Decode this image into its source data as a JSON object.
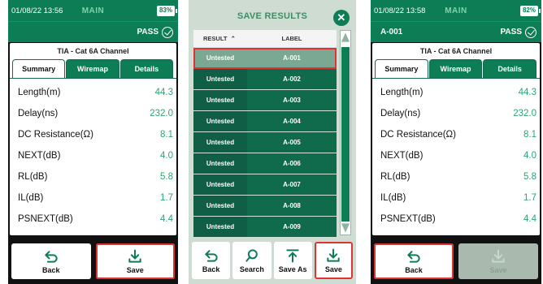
{
  "left": {
    "status": {
      "datetime": "01/08/22 13:56",
      "mode": "MAIN",
      "battery": "83%"
    },
    "header": {
      "label": "",
      "result": "PASS"
    },
    "title": "TIA - Cat 6A Channel",
    "tabs": [
      "Summary",
      "Wiremap",
      "Details"
    ],
    "rows": [
      {
        "label": "Length(m)",
        "value": "44.3"
      },
      {
        "label": "Delay(ns)",
        "value": "232.0"
      },
      {
        "label": "DC Resistance(Ω)",
        "value": "8.1"
      },
      {
        "label": "NEXT(dB)",
        "value": "4.0"
      },
      {
        "label": "RL(dB)",
        "value": "5.8"
      },
      {
        "label": "IL(dB)",
        "value": "1.7"
      },
      {
        "label": "PSNEXT(dB)",
        "value": "4.4"
      }
    ],
    "buttons": {
      "back": "Back",
      "save": "Save"
    }
  },
  "middle": {
    "title": "SAVE RESULTS",
    "close_symbol": "✕",
    "columns": {
      "result": "RESULT",
      "label": "LABEL",
      "sort_symbol": "⌃"
    },
    "rows": [
      {
        "result": "Untested",
        "label": "A-001"
      },
      {
        "result": "Untested",
        "label": "A-002"
      },
      {
        "result": "Untested",
        "label": "A-003"
      },
      {
        "result": "Untested",
        "label": "A-004"
      },
      {
        "result": "Untested",
        "label": "A-005"
      },
      {
        "result": "Untested",
        "label": "A-006"
      },
      {
        "result": "Untested",
        "label": "A-007"
      },
      {
        "result": "Untested",
        "label": "A-008"
      },
      {
        "result": "Untested",
        "label": "A-009"
      }
    ],
    "buttons": {
      "back": "Back",
      "search": "Search",
      "save_as": "Save As",
      "save": "Save"
    }
  },
  "right": {
    "status": {
      "datetime": "01/08/22 13:58",
      "mode": "MAIN",
      "battery": "82%"
    },
    "header": {
      "label": "A-001",
      "result": "PASS"
    },
    "title": "TIA - Cat 6A Channel",
    "tabs": [
      "Summary",
      "Wiremap",
      "Details"
    ],
    "rows": [
      {
        "label": "Length(m)",
        "value": "44.3"
      },
      {
        "label": "Delay(ns)",
        "value": "232.0"
      },
      {
        "label": "DC Resistance(Ω)",
        "value": "8.1"
      },
      {
        "label": "NEXT(dB)",
        "value": "4.0"
      },
      {
        "label": "RL(dB)",
        "value": "5.8"
      },
      {
        "label": "IL(dB)",
        "value": "1.7"
      },
      {
        "label": "PSNEXT(dB)",
        "value": "4.4"
      }
    ],
    "buttons": {
      "back": "Back",
      "save": "Save"
    }
  },
  "colors": {
    "brand_green": "#0c7d55",
    "value_green": "#2aa672",
    "highlight": "#dd3333"
  }
}
